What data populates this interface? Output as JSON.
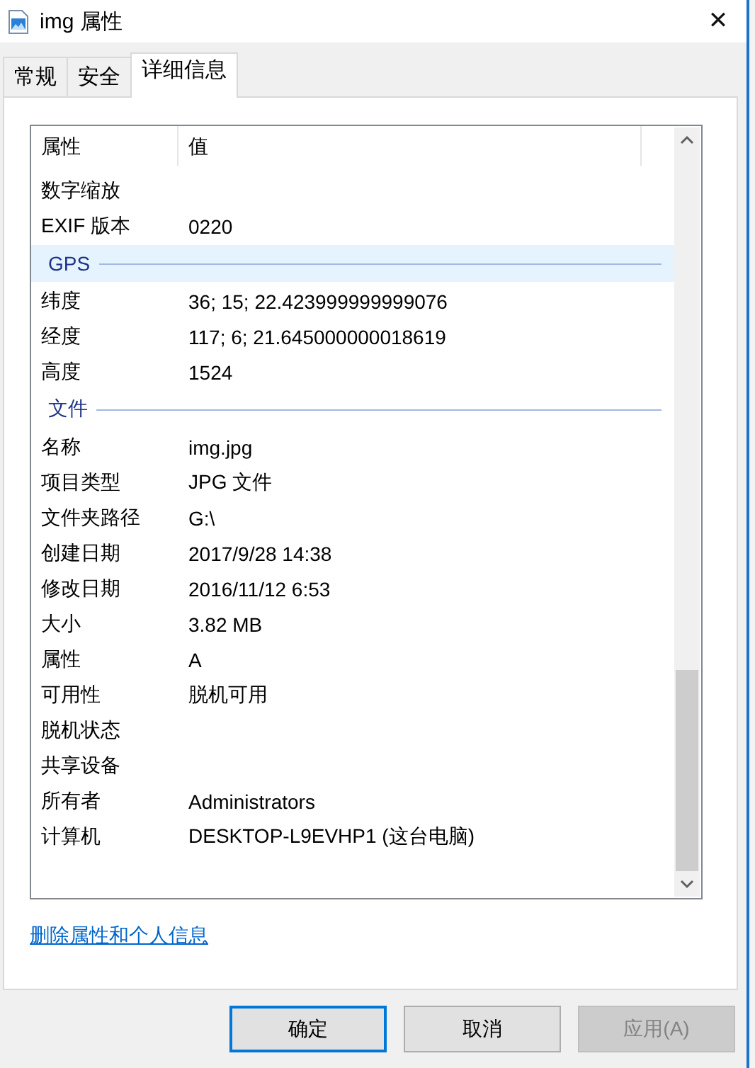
{
  "window": {
    "title": "img 属性",
    "close": "✕"
  },
  "tabs": [
    {
      "label": "常规",
      "selected": false
    },
    {
      "label": "安全",
      "selected": false
    },
    {
      "label": "详细信息",
      "selected": true
    }
  ],
  "details": {
    "columns": [
      "属性",
      "值"
    ],
    "rows": [
      {
        "kind": "property",
        "name": "数字缩放",
        "value": ""
      },
      {
        "kind": "property",
        "name": "EXIF 版本",
        "value": "0220"
      },
      {
        "kind": "group",
        "name": "GPS",
        "selected": true
      },
      {
        "kind": "property",
        "name": "纬度",
        "value": "36; 15; 22.423999999999076"
      },
      {
        "kind": "property",
        "name": "经度",
        "value": "117; 6; 21.645000000018619"
      },
      {
        "kind": "property",
        "name": "高度",
        "value": "1524"
      },
      {
        "kind": "group",
        "name": "文件",
        "selected": false
      },
      {
        "kind": "property",
        "name": "名称",
        "value": "img.jpg"
      },
      {
        "kind": "property",
        "name": "项目类型",
        "value": "JPG 文件"
      },
      {
        "kind": "property",
        "name": "文件夹路径",
        "value": "G:\\"
      },
      {
        "kind": "property",
        "name": "创建日期",
        "value": "2017/9/28 14:38"
      },
      {
        "kind": "property",
        "name": "修改日期",
        "value": "2016/11/12 6:53"
      },
      {
        "kind": "property",
        "name": "大小",
        "value": "3.82 MB"
      },
      {
        "kind": "property",
        "name": "属性",
        "value": "A"
      },
      {
        "kind": "property",
        "name": "可用性",
        "value": "脱机可用"
      },
      {
        "kind": "property",
        "name": "脱机状态",
        "value": ""
      },
      {
        "kind": "property",
        "name": "共享设备",
        "value": ""
      },
      {
        "kind": "property",
        "name": "所有者",
        "value": "Administrators"
      },
      {
        "kind": "property",
        "name": "计算机",
        "value": "DESKTOP-L9EVHP1 (这台电脑)"
      }
    ]
  },
  "link": "删除属性和个人信息",
  "buttons": [
    {
      "label": "确定",
      "default": true,
      "disabled": false
    },
    {
      "label": "取消",
      "default": false,
      "disabled": false
    },
    {
      "label": "应用(A)",
      "default": false,
      "disabled": true
    }
  ]
}
